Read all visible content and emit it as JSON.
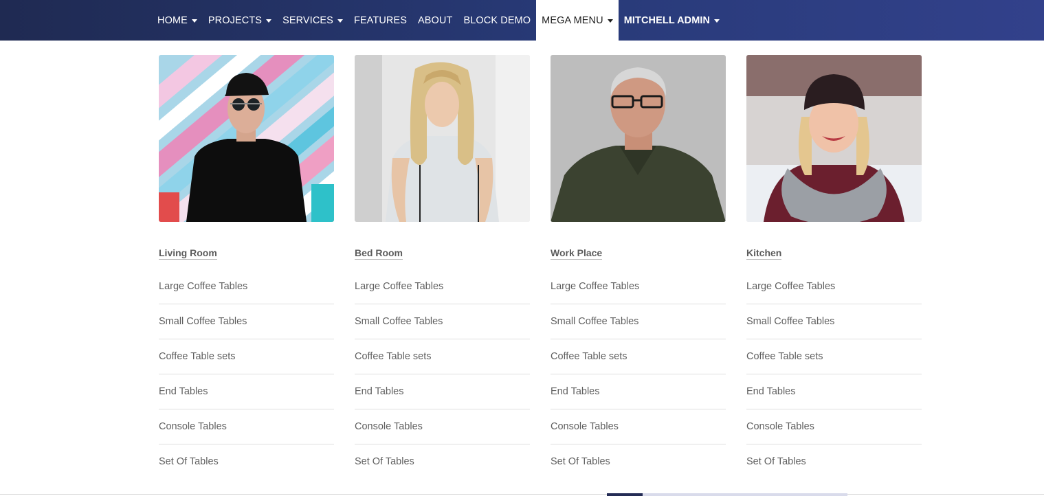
{
  "nav": {
    "items": [
      {
        "label": "HOME",
        "dropdown": true
      },
      {
        "label": "PROJECTS",
        "dropdown": true
      },
      {
        "label": "SERVICES",
        "dropdown": true
      },
      {
        "label": "FEATURES",
        "dropdown": false
      },
      {
        "label": "ABOUT",
        "dropdown": false
      },
      {
        "label": "BLOCK DEMO",
        "dropdown": false
      },
      {
        "label": "MEGA MENU",
        "dropdown": true,
        "active": true
      },
      {
        "label": "MITCHELL ADMIN",
        "dropdown": true,
        "bold": true
      }
    ]
  },
  "mega_menu": {
    "columns": [
      {
        "title": "Living Room",
        "image": "person-sunglasses-cap-colorful-wall",
        "links": [
          "Large Coffee Tables",
          "Small Coffee Tables",
          "Coffee Table sets",
          "End Tables",
          "Console Tables",
          "Set Of Tables"
        ]
      },
      {
        "title": "Bed Room",
        "image": "woman-blonde-white-hoodie",
        "links": [
          "Large Coffee Tables",
          "Small Coffee Tables",
          "Coffee Table sets",
          "End Tables",
          "Console Tables",
          "Set Of Tables"
        ]
      },
      {
        "title": "Work Place",
        "image": "older-man-glasses-green-polo",
        "links": [
          "Large Coffee Tables",
          "Small Coffee Tables",
          "Coffee Table sets",
          "End Tables",
          "Console Tables",
          "Set Of Tables"
        ]
      },
      {
        "title": "Kitchen",
        "image": "woman-beanie-scarf-winter",
        "links": [
          "Large Coffee Tables",
          "Small Coffee Tables",
          "Coffee Table sets",
          "End Tables",
          "Console Tables",
          "Set Of Tables"
        ]
      }
    ]
  },
  "colors": {
    "navbar_start": "#1f2a52",
    "navbar_end": "#32418b",
    "active_bg": "#ffffff",
    "link_text": "#5f5f5f",
    "divider": "#dedede"
  }
}
